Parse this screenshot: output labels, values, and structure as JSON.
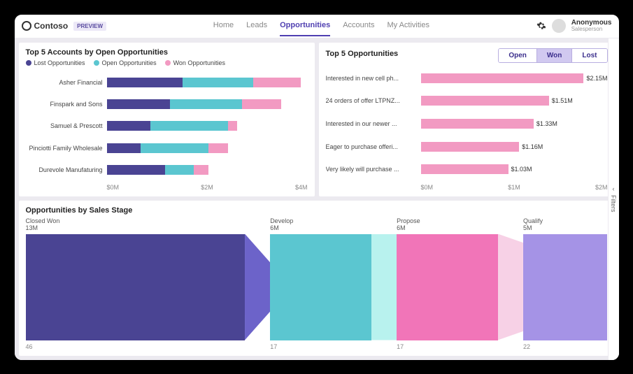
{
  "brand": {
    "name": "Contoso",
    "tag": "PREVIEW"
  },
  "nav": {
    "items": [
      "Home",
      "Leads",
      "Opportunities",
      "Accounts",
      "My Activities"
    ],
    "active_index": 2
  },
  "user": {
    "name": "Anonymous",
    "role": "Salesperson"
  },
  "side_panel": {
    "label": "Filters"
  },
  "colors": {
    "lost": "#4a4493",
    "open": "#5bc6d0",
    "won": "#f29ac2",
    "funnel": [
      "#4a4493",
      "#6c63c9",
      "#5bc6d0",
      "#b8f2ee",
      "#f175b8",
      "#f7d1e6",
      "#a593e6"
    ]
  },
  "cards": {
    "accounts": {
      "title": "Top 5 Accounts by Open Opportunities",
      "legend": [
        {
          "label": "Lost Opportunities",
          "colorKey": "lost"
        },
        {
          "label": "Open Opportunities",
          "colorKey": "open"
        },
        {
          "label": "Won Opportunities",
          "colorKey": "won"
        }
      ],
      "axis": [
        "$0M",
        "$2M",
        "$4M"
      ]
    },
    "topOpps": {
      "title": "Top 5 Opportunities",
      "pills": [
        "Open",
        "Won",
        "Lost"
      ],
      "active_pill": 1,
      "axis": [
        "$0M",
        "$1M",
        "$2M"
      ]
    },
    "funnel": {
      "title": "Opportunities by Sales Stage"
    }
  },
  "chart_data": [
    {
      "type": "bar",
      "orientation": "horizontal",
      "stacked": true,
      "title": "Top 5 Accounts by Open Opportunities",
      "xlabel": "",
      "ylabel": "",
      "xlim": [
        0,
        4
      ],
      "x_unit": "$M",
      "categories": [
        "Asher Financial",
        "Finspark and Sons",
        "Samuel & Prescott",
        "Pinciotti Family Wholesale",
        "Durevole Manufaturing"
      ],
      "series": [
        {
          "name": "Lost Opportunities",
          "color": "#4a4493",
          "values": [
            1.6,
            1.3,
            0.9,
            0.7,
            1.2
          ]
        },
        {
          "name": "Open Opportunities",
          "color": "#5bc6d0",
          "values": [
            1.5,
            1.5,
            1.6,
            1.4,
            0.6
          ]
        },
        {
          "name": "Won Opportunities",
          "color": "#f29ac2",
          "values": [
            1.0,
            0.8,
            0.2,
            0.4,
            0.3
          ]
        }
      ]
    },
    {
      "type": "bar",
      "orientation": "horizontal",
      "title": "Top 5 Opportunities",
      "xlabel": "",
      "ylabel": "",
      "xlim": [
        0,
        2.2
      ],
      "x_unit": "$M",
      "filter": "Won",
      "categories": [
        "Interested in new cell ph...",
        "24 orders of offer LTPNZ...",
        "Interested in our newer ...",
        "Eager to purchase offeri...",
        "Very likely will purchase ..."
      ],
      "values": [
        2.15,
        1.51,
        1.33,
        1.16,
        1.03
      ],
      "value_labels": [
        "$2.15M",
        "$1.51M",
        "$1.33M",
        "$1.16M",
        "$1.03M"
      ],
      "color": "#f29ac2"
    },
    {
      "type": "funnel",
      "title": "Opportunities by Sales Stage",
      "stages": [
        {
          "name": "Closed Won",
          "value": 13,
          "footer": 46,
          "unit": "M",
          "color": "#4a4493"
        },
        {
          "name": "Develop",
          "value": 6,
          "footer": 17,
          "unit": "M",
          "color": "#5bc6d0"
        },
        {
          "name": "Propose",
          "value": 6,
          "footer": 17,
          "unit": "M",
          "color": "#f175b8"
        },
        {
          "name": "Qualify",
          "value": 5,
          "footer": 22,
          "unit": "M",
          "color": "#a593e6"
        }
      ]
    }
  ]
}
